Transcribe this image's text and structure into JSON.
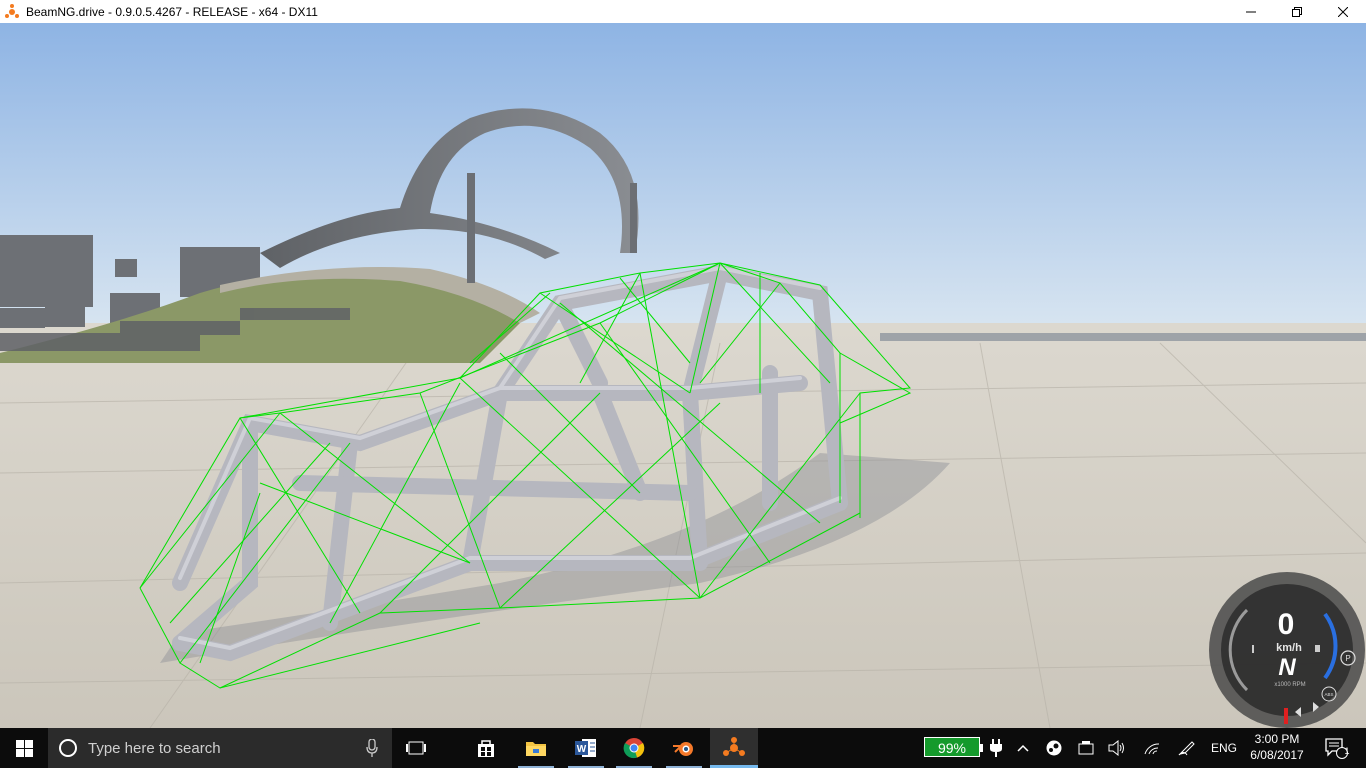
{
  "window": {
    "title": "BeamNG.drive - 0.9.0.5.4267 - RELEASE - x64 - DX11",
    "controls": [
      "minimize",
      "maximize",
      "close"
    ]
  },
  "hud": {
    "speed": "0",
    "unit": "km/h",
    "gear": "N",
    "rpm_label": "x1000 RPM",
    "indicators": [
      "P",
      "ABS"
    ]
  },
  "taskbar": {
    "search_placeholder": "Type here to search",
    "pinned_apps": [
      "task-view",
      "store",
      "file-explorer",
      "word",
      "chrome",
      "blender",
      "beamng"
    ],
    "battery": "99%",
    "language": "ENG",
    "time": "3:00 PM",
    "date": "6/08/2017",
    "notifications": "1"
  },
  "colors": {
    "sky_top": "#8eb4e4",
    "sky_bottom": "#d8e6f2",
    "ground": "#d4d0c6",
    "wireframe": "#00e000",
    "frame": "#b8b8c0",
    "battery_fill": "#159a2c"
  }
}
